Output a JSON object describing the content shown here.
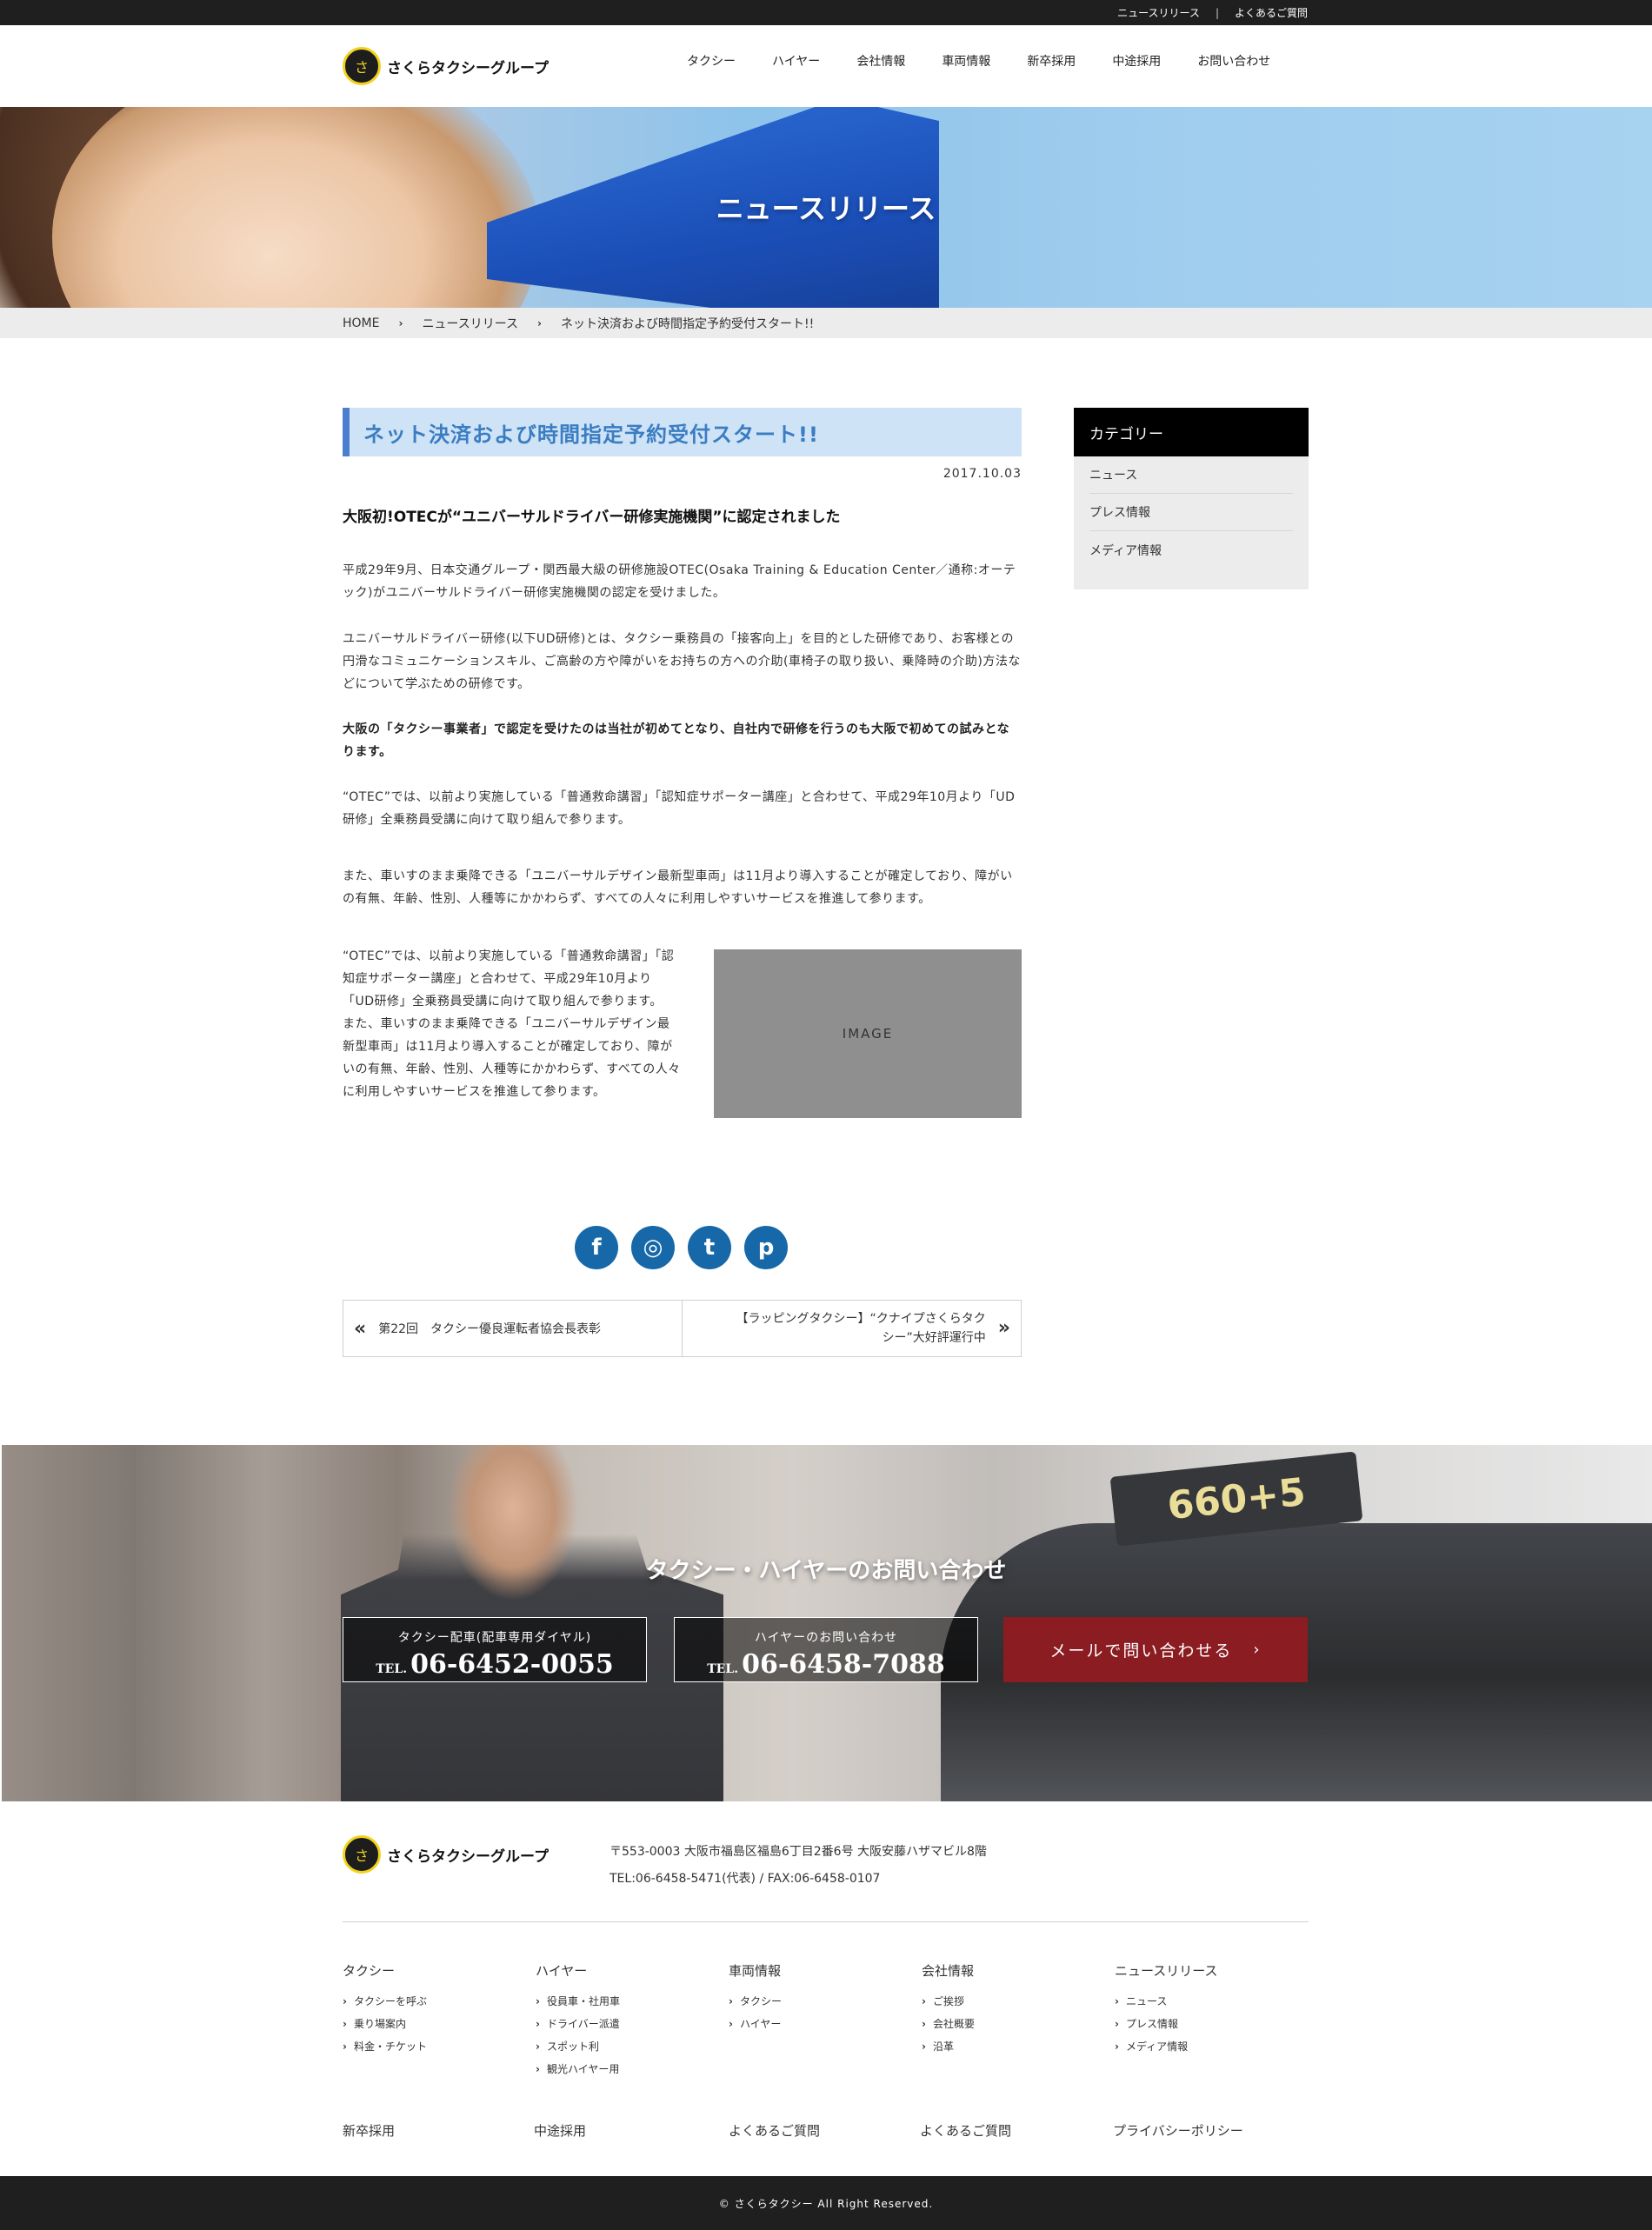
{
  "topbar": {
    "links": [
      "ニュースリリース",
      "よくあるご質問"
    ],
    "sep": "|"
  },
  "brand": {
    "mark": "さ",
    "name": "さくらタクシーグループ"
  },
  "nav": [
    "タクシー",
    "ハイヤー",
    "会社情報",
    "車両情報",
    "新卒採用",
    "中途採用",
    "お問い合わせ"
  ],
  "hero": {
    "title": "ニュースリリース"
  },
  "breadcrumb": {
    "items": [
      "HOME",
      "ニュースリリース",
      "ネット決済および時間指定予約受付スタート!!"
    ],
    "arrow": "›"
  },
  "article": {
    "title": "ネット決済および時間指定予約受付スタート!!",
    "date": "2017.10.03",
    "lead": "大阪初!OTECが“ユニバーサルドライバー研修実施機関”に認定されました",
    "p1": "平成29年9月、日本交通グループ・関西最大級の研修施設OTEC(Osaka Training & Education Center／通称:オーテック)がユニバーサルドライバー研修実施機関の認定を受けました。",
    "p2": "ユニバーサルドライバー研修(以下UD研修)とは、タクシー乗務員の「接客向上」を目的とした研修であり、お客様との円滑なコミュニケーションスキル、ご高齢の方や障がいをお持ちの方への介助(車椅子の取り扱い、乗降時の介助)方法などについて学ぶための研修です。",
    "p3": "大阪の「タクシー事業者」で認定を受けたのは当社が初めてとなり、自社内で研修を行うのも大阪で初めての試みとなります。",
    "p4": "“OTEC”では、以前より実施している「普通救命講習」「認知症サポーター講座」と合わせて、平成29年10月より「UD研修」全乗務員受講に向けて取り組んで参ります。",
    "p5": "また、車いすのまま乗降できる「ユニバーサルデザイン最新型車両」は11月より導入することが確定しており、障がいの有無、年齢、性別、人種等にかかわらず、すべての人々に利用しやすいサービスを推進して参ります。",
    "p6a": "“OTEC”では、以前より実施している「普通救命講習」「認知症サポーター講座」と合わせて、平成29年10月より「UD研修」全乗務員受講に向けて取り組んで参ります。",
    "p6b": "また、車いすのまま乗降できる「ユニバーサルデザイン最新型車両」は11月より導入することが確定しており、障がいの有無、年齢、性別、人種等にかかわらず、すべての人々に利用しやすいサービスを推進して参ります。",
    "image_label": "IMAGE"
  },
  "social": [
    {
      "name": "facebook-icon",
      "glyph": "f"
    },
    {
      "name": "instagram-icon",
      "glyph": "◎"
    },
    {
      "name": "twitter-icon",
      "glyph": "t"
    },
    {
      "name": "pinterest-icon",
      "glyph": "p"
    }
  ],
  "pager": {
    "prev": "第22回　タクシー優良運転者協会長表彰",
    "next": "【ラッピングタクシー】“クナイプさくらタクシー”大好評運行中",
    "prev_glyph": "«",
    "next_glyph": "»"
  },
  "sidebar": {
    "title": "カテゴリー",
    "items": [
      "ニュース",
      "プレス情報",
      "メディア情報"
    ]
  },
  "contact": {
    "title": "タクシー・ハイヤーのお問い合わせ",
    "sign": "660+5",
    "tel1": {
      "caption": "タクシー配車(配車専用ダイヤル)",
      "prefix": "TEL.",
      "number": "06-6452-0055"
    },
    "tel2": {
      "caption": "ハイヤーのお問い合わせ",
      "prefix": "TEL.",
      "number": "06-6458-7088"
    },
    "mail": {
      "label": "メールで問い合わせる",
      "arrow": "›"
    }
  },
  "footer": {
    "address": "〒553-0003 大阪市福島区福島6丁目2番6号 大阪安藤ハザマビル8階",
    "tel_fax": "TEL:06-6458-5471(代表) / FAX:06-6458-0107",
    "columns": [
      {
        "title": "タクシー",
        "items": [
          "タクシーを呼ぶ",
          "乗り場案内",
          "料金・チケット"
        ]
      },
      {
        "title": "ハイヤー",
        "items": [
          "役員車・社用車",
          "ドライバー派遣",
          "スポット利",
          "観光ハイヤー用"
        ]
      },
      {
        "title": "車両情報",
        "items": [
          "タクシー",
          "ハイヤー"
        ]
      },
      {
        "title": "会社情報",
        "items": [
          "ご挨拶",
          "会社概要",
          "沿革"
        ]
      },
      {
        "title": "ニュースリリース",
        "items": [
          "ニュース",
          "プレス情報",
          "メディア情報"
        ]
      }
    ],
    "bottom_links": [
      "新卒採用",
      "中途採用",
      "よくあるご質問",
      "よくあるご質問",
      "プライバシーポリシー"
    ],
    "copyright": "© さくらタクシー All Right Reserved."
  }
}
